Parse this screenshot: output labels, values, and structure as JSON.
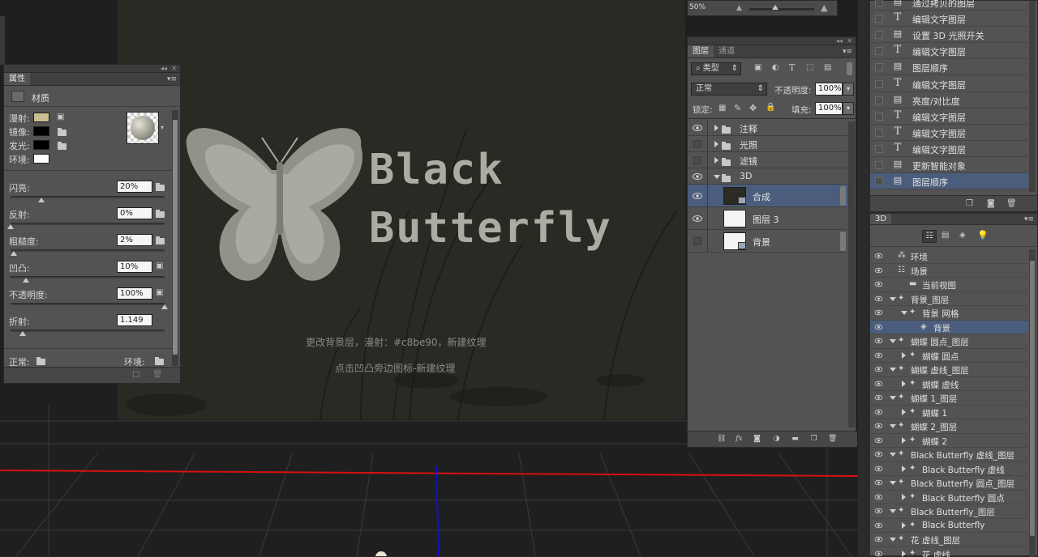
{
  "properties_panel": {
    "tab": "属性",
    "section_title": "材质",
    "color_rows": [
      {
        "label": "漫射:",
        "color": "#c8be90"
      },
      {
        "label": "镜像:",
        "color": "#000000"
      },
      {
        "label": "发光:",
        "color": "#000000"
      },
      {
        "label": "环境:",
        "color": "#ffffff"
      }
    ],
    "sliders": [
      {
        "label": "闪亮:",
        "value": "20%",
        "level": 0.2
      },
      {
        "label": "反射:",
        "value": "0%",
        "level": 0.0
      },
      {
        "label": "粗糙度:",
        "value": "2%",
        "level": 0.02
      },
      {
        "label": "凹凸:",
        "value": "10%",
        "level": 0.1
      },
      {
        "label": "不透明度:",
        "value": "100%",
        "level": 1.0
      },
      {
        "label": "折射:",
        "value": "1.149",
        "level": 0.08
      }
    ],
    "normal_label": "正常:",
    "env_label": "环境:"
  },
  "canvas": {
    "title_line1": "Black",
    "title_line2": "Butterfly",
    "caption1": "更改背景层，漫射：#c8be90，新建纹理",
    "caption2": "点击凹凸旁边图标-新建纹理",
    "zoom": "50%"
  },
  "layers_panel": {
    "tabs": [
      "图层",
      "通道"
    ],
    "kind_filter": "类型",
    "blend_mode": "正常",
    "opacity_label": "不透明度:",
    "opacity_value": "100%",
    "lock_label": "锁定:",
    "fill_label": "填充:",
    "fill_value": "100%",
    "layers": [
      {
        "name": "注释",
        "type": "group",
        "visible": true,
        "expanded": false
      },
      {
        "name": "光照",
        "type": "group",
        "visible": false,
        "expanded": false
      },
      {
        "name": "滤镜",
        "type": "group",
        "visible": false,
        "expanded": false
      },
      {
        "name": "3D",
        "type": "group",
        "visible": true,
        "expanded": true
      },
      {
        "name": "合成",
        "type": "3d",
        "visible": true,
        "selected": true
      },
      {
        "name": "图层 3",
        "type": "layer",
        "visible": true
      },
      {
        "name": "背景",
        "type": "3d",
        "visible": false
      }
    ]
  },
  "history_panel": {
    "items": [
      {
        "icon": "doc",
        "label": "通过拷贝的图层"
      },
      {
        "icon": "T",
        "label": "编辑文字图层"
      },
      {
        "icon": "doc",
        "label": "设置 3D 光照开关"
      },
      {
        "icon": "T",
        "label": "编辑文字图层"
      },
      {
        "icon": "doc",
        "label": "图层顺序"
      },
      {
        "icon": "T",
        "label": "编辑文字图层"
      },
      {
        "icon": "doc",
        "label": "亮度/对比度"
      },
      {
        "icon": "T",
        "label": "编辑文字图层"
      },
      {
        "icon": "T",
        "label": "编辑文字图层"
      },
      {
        "icon": "T",
        "label": "编辑文字图层"
      },
      {
        "icon": "doc",
        "label": "更新智能对象"
      },
      {
        "icon": "doc",
        "label": "图层顺序",
        "selected": true
      }
    ]
  },
  "panel_3d": {
    "tab": "3D",
    "items": [
      {
        "label": "环境",
        "level": 0,
        "arrow": "none",
        "icon": "env"
      },
      {
        "label": "场景",
        "level": 0,
        "arrow": "none",
        "icon": "scene"
      },
      {
        "label": "当前视图",
        "level": 1,
        "arrow": "none",
        "icon": "camera"
      },
      {
        "label": "背景_图层",
        "level": 0,
        "arrow": "down",
        "icon": "mesh"
      },
      {
        "label": "背景 网格",
        "level": 1,
        "arrow": "down",
        "icon": "mesh"
      },
      {
        "label": "背景",
        "level": 2,
        "arrow": "none",
        "icon": "material",
        "selected": true
      },
      {
        "label": "蝴蝶 圆点_图层",
        "level": 0,
        "arrow": "down",
        "icon": "mesh"
      },
      {
        "label": "蝴蝶 圆点",
        "level": 1,
        "arrow": "right",
        "icon": "mesh"
      },
      {
        "label": "蝴蝶 虚线_图层",
        "level": 0,
        "arrow": "down",
        "icon": "mesh"
      },
      {
        "label": "蝴蝶 虚线",
        "level": 1,
        "arrow": "right",
        "icon": "mesh"
      },
      {
        "label": "蝴蝶 1_图层",
        "level": 0,
        "arrow": "down",
        "icon": "mesh"
      },
      {
        "label": "蝴蝶 1",
        "level": 1,
        "arrow": "right",
        "icon": "mesh"
      },
      {
        "label": "蝴蝶 2_图层",
        "level": 0,
        "arrow": "down",
        "icon": "mesh"
      },
      {
        "label": "蝴蝶 2",
        "level": 1,
        "arrow": "right",
        "icon": "mesh"
      },
      {
        "label": "Black Butterfly 虚线_图层",
        "level": 0,
        "arrow": "down",
        "icon": "mesh"
      },
      {
        "label": "Black Butterfly 虚线",
        "level": 1,
        "arrow": "right",
        "icon": "mesh"
      },
      {
        "label": "Black Butterfly 圆点_图层",
        "level": 0,
        "arrow": "down",
        "icon": "mesh"
      },
      {
        "label": "Black Butterfly 圆点",
        "level": 1,
        "arrow": "right",
        "icon": "mesh"
      },
      {
        "label": "Black Butterfly_图层",
        "level": 0,
        "arrow": "down",
        "icon": "mesh"
      },
      {
        "label": "Black Butterfly",
        "level": 1,
        "arrow": "right",
        "icon": "mesh"
      },
      {
        "label": "花 虚线_图层",
        "level": 0,
        "arrow": "down",
        "icon": "mesh"
      },
      {
        "label": "花 虚线",
        "level": 1,
        "arrow": "right",
        "icon": "mesh"
      }
    ]
  },
  "colors": {
    "selection": "#4b5d7c",
    "panel_bg": "#535353",
    "axis_red": "#d81010",
    "axis_blue": "#1010c8"
  }
}
